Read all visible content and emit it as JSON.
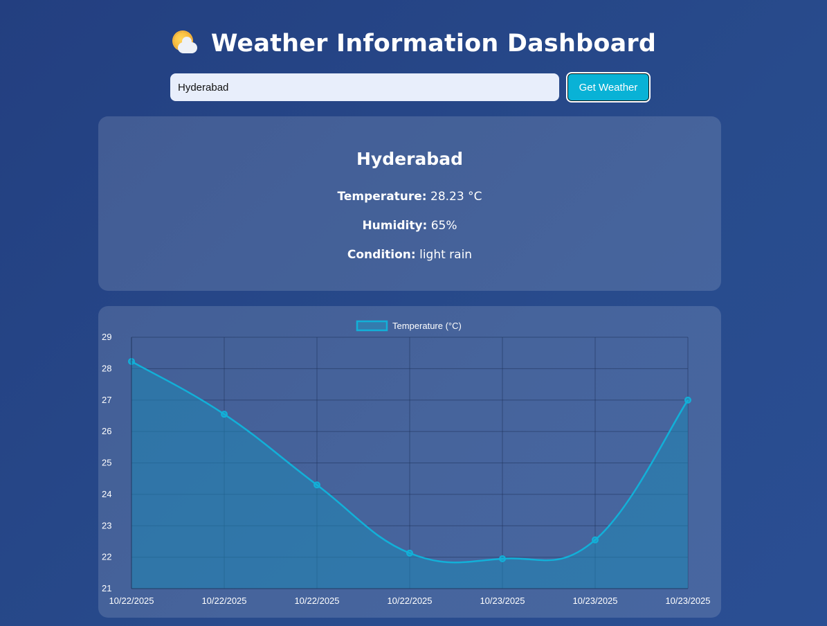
{
  "header": {
    "title": "Weather Information Dashboard",
    "icon": "sun-behind-cloud-icon"
  },
  "search": {
    "value": "Hyderabad",
    "button_label": "Get Weather"
  },
  "weather": {
    "city": "Hyderabad",
    "temperature_label": "Temperature:",
    "temperature_value": "28.23 °C",
    "humidity_label": "Humidity:",
    "humidity_value": "65%",
    "condition_label": "Condition:",
    "condition_value": "light rain"
  },
  "colors": {
    "accent": "#09b2d6",
    "line": "#12b0d8",
    "fill": "#1f86b4",
    "card": "#4a649c"
  },
  "chart_data": {
    "type": "area",
    "categories": [
      "10/22/2025",
      "10/22/2025",
      "10/22/2025",
      "10/22/2025",
      "10/23/2025",
      "10/23/2025",
      "10/23/2025"
    ],
    "series": [
      {
        "name": "Temperature (°C)",
        "values": [
          28.23,
          26.55,
          24.3,
          22.13,
          21.95,
          22.55,
          27.0
        ]
      }
    ],
    "ylim": [
      21,
      29
    ],
    "yticks": [
      21,
      22,
      23,
      24,
      25,
      26,
      27,
      28,
      29
    ],
    "grid": true,
    "legend": "top-center",
    "xlabel": "",
    "ylabel": ""
  }
}
